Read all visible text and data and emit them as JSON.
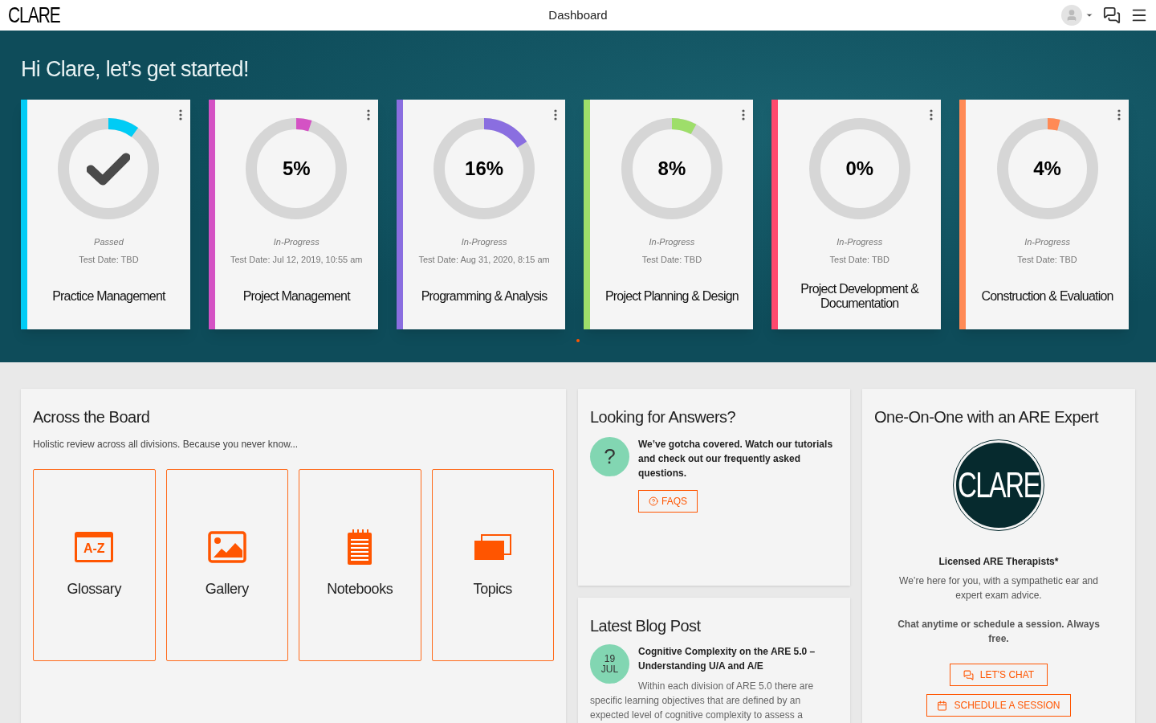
{
  "header": {
    "logo": "CLARE",
    "title": "Dashboard"
  },
  "greeting": "Hi Clare, let’s get started!",
  "divisions": [
    {
      "kind": "passed",
      "color": "#00ccf5",
      "level": 0.1,
      "status": "Passed",
      "test_date": "Test Date: TBD",
      "name": "Practice Management"
    },
    {
      "kind": "progress",
      "color": "#d452c4",
      "level": 0.05,
      "percent": "5%",
      "status": "In-Progress",
      "test_date": "Test Date: Jul 12, 2019, 10:55 am",
      "name": "Project Management"
    },
    {
      "kind": "progress",
      "color": "#8a6ee0",
      "level": 0.16,
      "percent": "16%",
      "status": "In-Progress",
      "test_date": "Test Date: Aug 31, 2020, 8:15 am",
      "name": "Programming & Analysis"
    },
    {
      "kind": "progress",
      "color": "#9ede6a",
      "level": 0.08,
      "percent": "8%",
      "status": "In-Progress",
      "test_date": "Test Date: TBD",
      "name": "Project Planning & Design"
    },
    {
      "kind": "progress",
      "color": "#ff4a6e",
      "percent": "0%",
      "status": "In-Progress",
      "test_date": "Test Date: TBD",
      "name": "Project Development & Documentation"
    },
    {
      "kind": "progress",
      "color": "#ff8a55",
      "level": 0.04,
      "percent": "4%",
      "status": "In-Progress",
      "test_date": "Test Date: TBD",
      "name": "Construction & Evaluation"
    }
  ],
  "across_the_board": {
    "title": "Across the Board",
    "subtitle": "Holistic review across all divisions. Because you never know...",
    "tiles": [
      {
        "kind": "glossary",
        "label": "Glossary",
        "icon_text": "A-Z"
      },
      {
        "kind": "gallery",
        "label": "Gallery"
      },
      {
        "kind": "notebooks",
        "label": "Notebooks"
      },
      {
        "kind": "topics",
        "label": "Topics"
      }
    ]
  },
  "answers": {
    "title": "Looking for Answers?",
    "badge": "?",
    "text": "We’ve gotcha covered. Watch our tutorials and check out our frequently asked questions.",
    "button": "FAQS"
  },
  "blog": {
    "title": "Latest Blog Post",
    "day": "19",
    "month": "JUL",
    "post_title": "Cognitive Complexity on the ARE 5.0 – Understanding U/A and A/E",
    "excerpt": "Within each division of ARE 5.0 there are specific learning objectives that are defined by an expected level of cognitive complexity to assess a"
  },
  "expert": {
    "title": "One-On-One with an ARE Expert",
    "logo": "CLARE",
    "heading": "Licensed ARE Therapists*",
    "text": "We’re here for you, with a sympathetic ear and expert exam advice.",
    "cta": "Chat anytime or schedule a session. Always free.",
    "buttons": [
      "LET'S CHAT",
      "SCHEDULE A SESSION"
    ]
  }
}
